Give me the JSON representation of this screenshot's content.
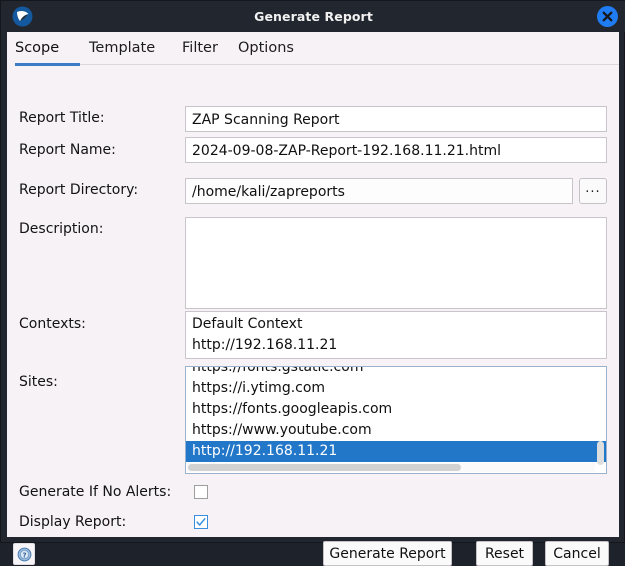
{
  "window": {
    "title": "Generate Report",
    "app_icon": "zap-logo-icon",
    "close_icon": "close-icon"
  },
  "tabs": [
    {
      "label": "Scope",
      "active": true
    },
    {
      "label": "Template",
      "active": false
    },
    {
      "label": "Filter",
      "active": false
    },
    {
      "label": "Options",
      "active": false
    }
  ],
  "form": {
    "report_title": {
      "label": "Report Title:",
      "value": "ZAP Scanning Report"
    },
    "report_name": {
      "label": "Report Name:",
      "value": "2024-09-08-ZAP-Report-192.168.11.21.html"
    },
    "report_directory": {
      "label": "Report Directory:",
      "value": "/home/kali/zapreports",
      "browse_label": "..."
    },
    "description": {
      "label": "Description:",
      "value": ""
    },
    "contexts": {
      "label": "Contexts:",
      "items": [
        "Default Context",
        "http://192.168.11.21"
      ]
    },
    "sites": {
      "label": "Sites:",
      "items": [
        "https://fonts.gstatic.com",
        "https://i.ytimg.com",
        "https://fonts.googleapis.com",
        "https://www.youtube.com",
        "http://192.168.11.21"
      ],
      "selected_index": 4
    },
    "generate_if_no_alerts": {
      "label": "Generate If No Alerts:",
      "checked": false
    },
    "display_report": {
      "label": "Display Report:",
      "checked": true
    }
  },
  "footer": {
    "help_icon": "help-icon",
    "buttons": [
      {
        "label": "Generate Report"
      },
      {
        "label": "Reset"
      },
      {
        "label": "Cancel"
      }
    ]
  },
  "colors": {
    "titlebar_bg": "#22262e",
    "dialog_bg": "#f7f2f6",
    "accent_blue": "#3c7cc4",
    "selection_blue": "#2277c8",
    "close_blue": "#1f7cf2"
  }
}
